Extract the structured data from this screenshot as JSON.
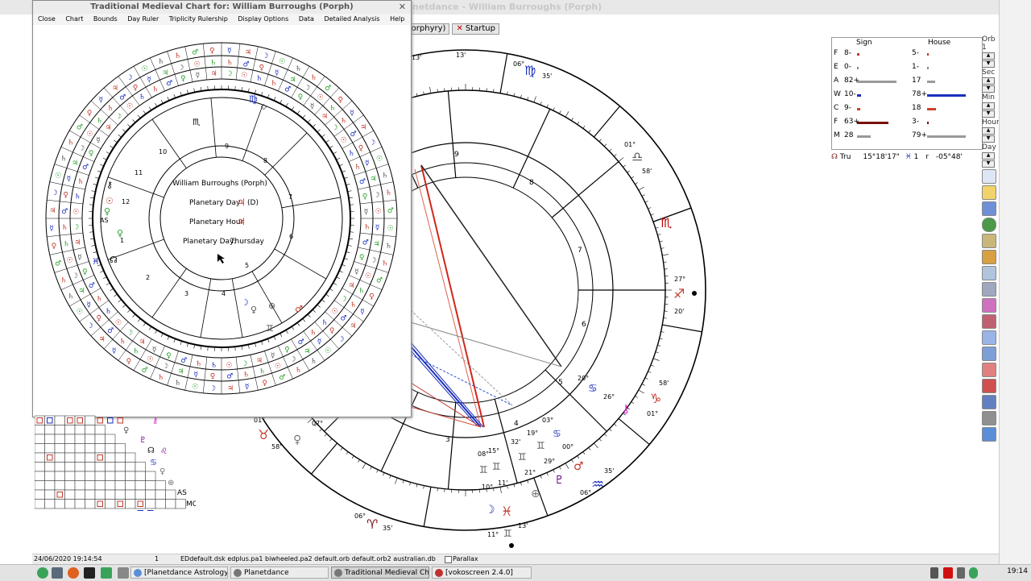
{
  "main_window": {
    "title": "Planetdance - William Burroughs (Porph)",
    "tabs": [
      {
        "label": "Porphyry)"
      },
      {
        "label": "Startup"
      }
    ]
  },
  "side_labels": [
    "Orb",
    "1",
    "Sec",
    "Min",
    "Hour",
    "Day"
  ],
  "sign_house": {
    "header_sign": "Sign",
    "header_house": "House",
    "rows": [
      {
        "el": "F",
        "sign": "8-",
        "sign_frac": 0.05,
        "house": "5-",
        "house_frac": 0.04,
        "color": "#c0392b"
      },
      {
        "el": "E",
        "sign": "0-",
        "sign_frac": 0.0,
        "house": "1-",
        "house_frac": 0.01,
        "color": "#888888"
      },
      {
        "el": "A",
        "sign": "82+",
        "sign_frac": 0.95,
        "house": "17",
        "house_frac": 0.2,
        "color": "#999999"
      },
      {
        "el": "W",
        "sign": "10-",
        "sign_frac": 0.1,
        "house": "78+",
        "house_frac": 0.95,
        "color": "#1a2fbf"
      },
      {
        "el": "C",
        "sign": "9-",
        "sign_frac": 0.08,
        "house": "18",
        "house_frac": 0.22,
        "color": "#d0402a"
      },
      {
        "el": "F",
        "sign": "63+",
        "sign_frac": 0.75,
        "house": "3-",
        "house_frac": 0.04,
        "color": "#7a1010"
      },
      {
        "el": "M",
        "sign": "28",
        "sign_frac": 0.33,
        "house": "79+",
        "house_frac": 0.95,
        "color": "#999999"
      }
    ]
  },
  "node_line": {
    "label": "Tru",
    "pos": "15°18'17\"",
    "ret": "1",
    "r": "r",
    "lat": "-05°48'"
  },
  "medieval": {
    "title": "Traditional Medieval Chart for: William Burroughs (Porph)",
    "menu": [
      "Close",
      "Chart",
      "Bounds",
      "Day Ruler",
      "Triplicity Rulership",
      "Display Options",
      "Data",
      "Detailed Analysis",
      "Help"
    ],
    "center": {
      "name": "William Burroughs (Porph)",
      "day_label": "Planetary Day",
      "day_glyph": "♃",
      "day_suffix": "(D)",
      "hour_label": "Planetary Hour",
      "hour_glyph": "♃",
      "dayname_label": "Planetary Day:",
      "dayname": "Thursday"
    }
  },
  "status_bar": {
    "datetime": "24/06/2020 19:14:54",
    "num": "1",
    "files": "EDdefault.dsk edplus.pa1 biwheeled.pa2 default.orb default.orb2 australian.db",
    "parallax": "Parallax"
  },
  "taskbar": {
    "tasks": [
      {
        "label": "[Planetdance Astrology Soft...",
        "active": false
      },
      {
        "label": "Planetdance",
        "active": false
      },
      {
        "label": "Traditional Medieval Chart f...",
        "active": true
      },
      {
        "label": "[vokoscreen 2.4.0]",
        "active": false
      }
    ],
    "clock": "19:14"
  }
}
